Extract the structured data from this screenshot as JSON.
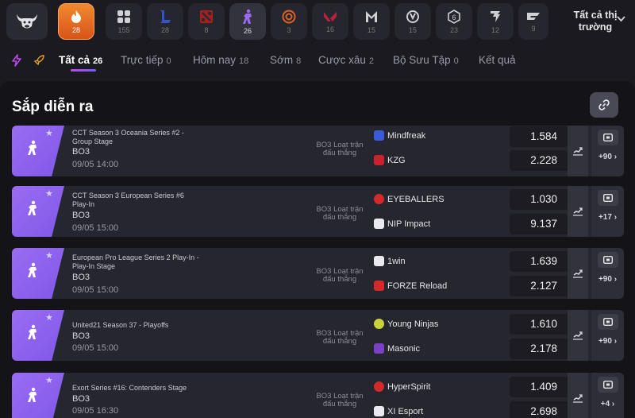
{
  "top_tabs": [
    {
      "name": "home-logo",
      "count": ""
    },
    {
      "name": "hot",
      "count": "28"
    },
    {
      "name": "all-games",
      "count": "155"
    },
    {
      "name": "lol",
      "count": "28"
    },
    {
      "name": "dota2",
      "count": "8"
    },
    {
      "name": "cs",
      "count": "26"
    },
    {
      "name": "overwatch-orange",
      "count": "3"
    },
    {
      "name": "valorant",
      "count": "16"
    },
    {
      "name": "mobile-legends",
      "count": "15"
    },
    {
      "name": "overwatch",
      "count": "15"
    },
    {
      "name": "rainbow-six",
      "count": "23"
    },
    {
      "name": "starcraft",
      "count": "12"
    },
    {
      "name": "crossfire",
      "count": "9"
    }
  ],
  "markets_label": "Tất cả thị trường",
  "filters": [
    {
      "label": "Tất cả",
      "count": "26"
    },
    {
      "label": "Trực tiếp",
      "count": "0"
    },
    {
      "label": "Hôm nay",
      "count": "18"
    },
    {
      "label": "Sớm",
      "count": "8"
    },
    {
      "label": "Cược xâu",
      "count": "2"
    },
    {
      "label": "Bộ Sưu Tập",
      "count": "0"
    },
    {
      "label": "Kết quả",
      "count": ""
    }
  ],
  "section_title": "Sắp diễn ra",
  "matches": [
    {
      "league": "CCT Season 3 Oceania Series #2 - Group Stage",
      "format": "BO3",
      "time": "09/05 14:00",
      "type": "BO3 Loạt trận đấu thắng",
      "team1": "Mindfreak",
      "team2": "KZG",
      "odd1": "1.584",
      "odd2": "2.228",
      "more": "+90 ›"
    },
    {
      "league": "CCT Season 3 European Series #6 Play-In",
      "format": "BO3",
      "time": "09/05 15:00",
      "type": "BO3 Loạt trận đấu thắng",
      "team1": "EYEBALLERS",
      "team2": "NIP Impact",
      "odd1": "1.030",
      "odd2": "9.137",
      "more": "+17 ›"
    },
    {
      "league": "European Pro League Series 2 Play-In - Play-In Stage",
      "format": "BO3",
      "time": "09/05 15:00",
      "type": "BO3 Loạt trận đấu thắng",
      "team1": "1win",
      "team2": "FORZE Reload",
      "odd1": "1.639",
      "odd2": "2.127",
      "more": "+90 ›"
    },
    {
      "league": "United21 Season 37 - Playoffs",
      "format": "BO3",
      "time": "09/05 15:00",
      "type": "BO3 Loạt trận đấu thắng",
      "team1": "Young Ninjas",
      "team2": "Masonic",
      "odd1": "1.610",
      "odd2": "2.178",
      "more": "+90 ›"
    },
    {
      "league": "Exort Series #16: Contenders Stage",
      "format": "BO3",
      "time": "09/05 16:30",
      "type": "BO3 Loạt trận đấu thắng",
      "team1": "HyperSpirit",
      "team2": "XI Esport",
      "odd1": "1.409",
      "odd2": "2.698",
      "more": "+4 ›"
    }
  ],
  "colors": {
    "accent": "#8b5cf6",
    "hot": "#e8702a",
    "background": "#141418"
  }
}
